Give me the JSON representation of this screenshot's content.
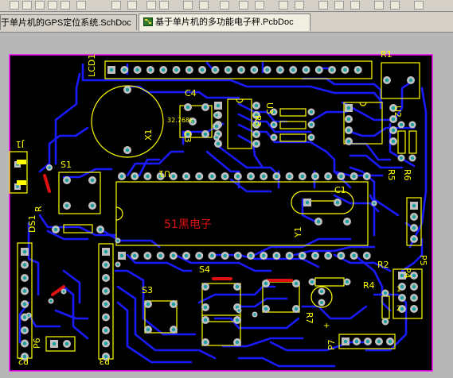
{
  "tabs": [
    {
      "label": "于单片机的GPS定位系统.SchDoc",
      "active": false
    },
    {
      "label": "基于单片机的多功能电子秤.PcbDoc",
      "active": true
    }
  ],
  "board": {
    "center_text": "51黑电子",
    "crystal_x1": "32.768k",
    "designators": [
      "LCD1",
      "R1",
      "C4",
      "X1",
      "C3",
      "U3",
      "R3",
      "U2",
      "R5",
      "R6",
      "J1",
      "S1",
      "U1",
      "C1",
      "Y1",
      "DS1",
      "R",
      "P5",
      "R2",
      "S4",
      "S3",
      "R4",
      "P4",
      "R7",
      "P6",
      "P2",
      "P3",
      "P7"
    ]
  },
  "colors": {
    "board": "#000000",
    "outline": "#ff00ff",
    "silk": "#ffff00",
    "trace": "#1a1aff",
    "pad": "#c0c0c0",
    "pad_hole": "#1aa0a0",
    "jumper": "#e01010",
    "center_text": "#e01010"
  },
  "icons": [
    "schematic-doc-icon",
    "pcb-doc-icon"
  ]
}
